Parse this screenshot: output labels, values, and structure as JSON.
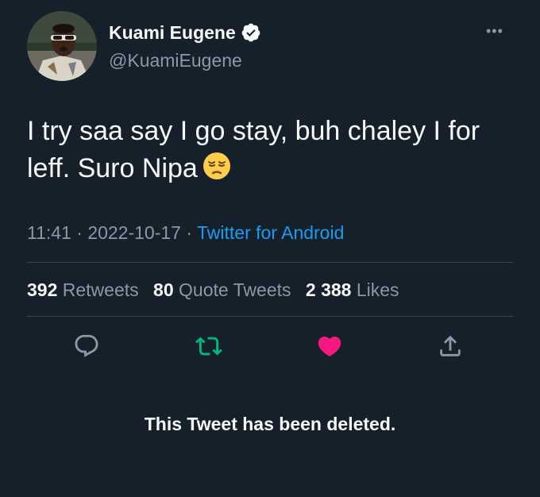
{
  "tweet": {
    "author": {
      "display_name": "Kuami Eugene",
      "handle": "@KuamiEugene",
      "verified": true,
      "avatar_icon": "profile-photo"
    },
    "more_icon": "more-options-icon",
    "text_line1": "I try saa say I go stay, buh chaley I for",
    "text_line2": "leff. Suro Nipa",
    "emoji": "pensive-face-emoji",
    "time": "11:41",
    "separator": "·",
    "date": "2022-10-17",
    "source": "Twitter for Android",
    "stats": {
      "retweets_count": "392",
      "retweets_label": "Retweets",
      "quotes_count": "80",
      "quotes_label": "Quote Tweets",
      "likes_count": "2 388",
      "likes_label": "Likes"
    },
    "actions": [
      {
        "name": "reply",
        "icon": "reply-icon",
        "color": "#8b98a5"
      },
      {
        "name": "retweet",
        "icon": "retweet-icon",
        "color": "#00ba7c"
      },
      {
        "name": "like",
        "icon": "heart-icon",
        "color": "#f91880"
      },
      {
        "name": "share",
        "icon": "share-icon",
        "color": "#8b98a5"
      }
    ],
    "deleted_notice": "This Tweet has been deleted."
  },
  "colors": {
    "background": "#15202b",
    "primary_text": "#f7f9f9",
    "secondary_text": "#8b98a5",
    "link": "#1d9bf0",
    "divider": "#38444d",
    "retweet_active": "#00ba7c",
    "like_active": "#f91880"
  }
}
